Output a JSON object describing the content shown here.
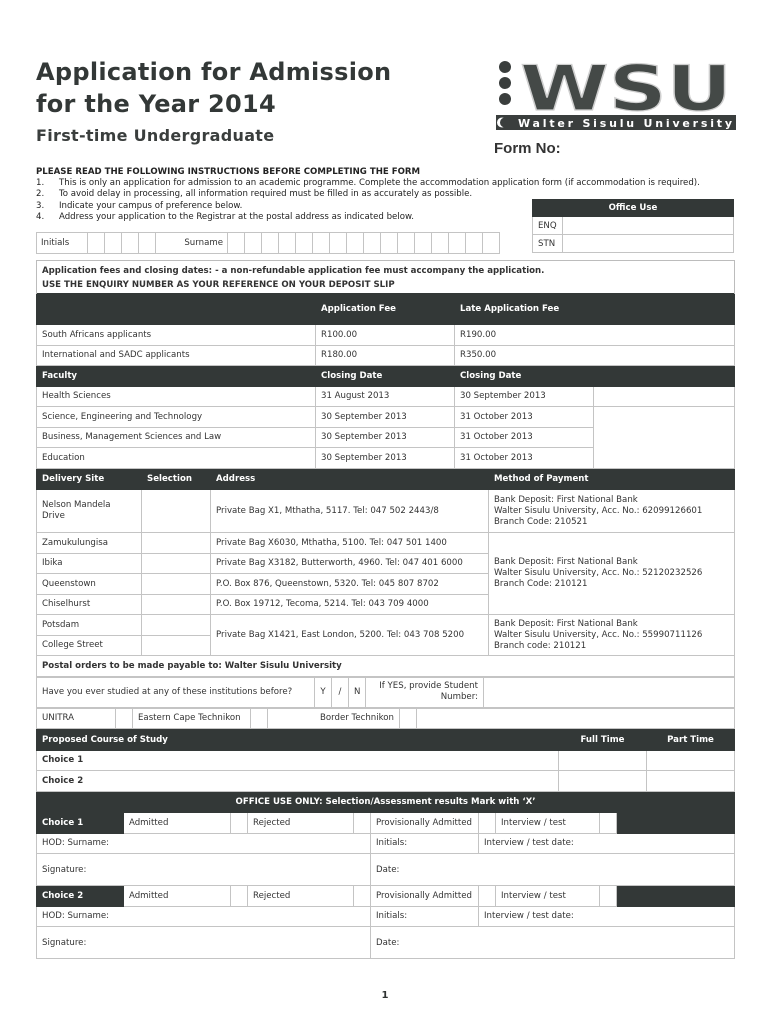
{
  "header": {
    "title_line1": "Application for Admission",
    "title_line2": "for the Year 2014",
    "subtitle": "First-time Undergraduate",
    "logo_text": "WSU",
    "logo_tagline": "Walter Sisulu University",
    "form_no_label": "Form No:"
  },
  "instructions": {
    "title": "PLEASE READ THE FOLLOWING INSTRUCTIONS BEFORE COMPLETING THE FORM",
    "items": [
      {
        "num": "1.",
        "text": "This is only an application for admission to an academic programme. Complete the accommodation application form (if accommodation is required)."
      },
      {
        "num": "2.",
        "text": "To avoid delay in processing, all information required must be filled in as accurately as possible."
      },
      {
        "num": "3.",
        "text": "Indicate your campus of preference below."
      },
      {
        "num": "4.",
        "text": "Address your application to the Registrar at the postal address as indicated below."
      }
    ]
  },
  "office_use": {
    "title": "Office Use",
    "rows": [
      {
        "label": "ENQ",
        "value": ""
      },
      {
        "label": "STN",
        "value": ""
      }
    ]
  },
  "name_row": {
    "initials_label": "Initials",
    "surname_label": "Surname",
    "initials_boxes": 4,
    "surname_boxes": 16
  },
  "fees": {
    "intro": "Application fees and closing dates: - a non-refundable application fee must accompany the application.",
    "reference_note": "USE THE ENQUIRY NUMBER AS YOUR REFERENCE ON YOUR DEPOSIT SLIP",
    "columns": [
      "",
      "Application Fee",
      "Late Application Fee"
    ],
    "rows": [
      {
        "applicant": "South Africans applicants",
        "fee": "R100.00",
        "late_fee": "R190.00"
      },
      {
        "applicant": "International and SADC applicants",
        "fee": "R180.00",
        "late_fee": "R350.00"
      }
    ]
  },
  "closing": {
    "columns": [
      "Faculty",
      "Closing Date",
      "Closing Date"
    ],
    "rows": [
      {
        "faculty": "Health Sciences",
        "date1": "31 August 2013",
        "date2": "30 September 2013"
      },
      {
        "faculty": "Science, Engineering and Technology",
        "date1": "30 September 2013",
        "date2": "31 October 2013"
      },
      {
        "faculty": "Business, Management Sciences and Law",
        "date1": "30 September 2013",
        "date2": "31 October 2013"
      },
      {
        "faculty": "Education",
        "date1": "30 September 2013",
        "date2": "31 October 2013"
      }
    ]
  },
  "delivery": {
    "columns": [
      "Delivery Site",
      "Selection",
      "Address",
      "Method of Payment"
    ],
    "sites": [
      {
        "site": "Nelson Mandela Drive",
        "address": "Private Bag X1, Mthatha, 5117.  Tel: 047 502 2443/8"
      },
      {
        "site": "Zamukulungisa",
        "address": "Private Bag X6030, Mthatha, 5100.  Tel: 047 501 1400"
      },
      {
        "site": "Ibika",
        "address": "Private Bag X3182, Butterworth, 4960.  Tel: 047 401 6000"
      },
      {
        "site": "Queenstown",
        "address": "P.O. Box 876, Queenstown, 5320.  Tel: 045 807 8702"
      },
      {
        "site": "Chiselhurst",
        "address": "P.O. Box 19712, Tecoma, 5214.  Tel: 043 709 4000"
      },
      {
        "site": "Potsdam",
        "address": "Private Bag X1421, East London, 5200.  Tel: 043 708 5200"
      },
      {
        "site": "College Street",
        "address": ""
      }
    ],
    "payments": [
      {
        "line1": "Bank Deposit:  First National Bank",
        "line2": "Walter Sisulu University, Acc. No.: 62099126601",
        "line3": "Branch Code: 210521"
      },
      {
        "line1": "Bank Deposit:  First National Bank",
        "line2": "Walter Sisulu University, Acc. No.: 52120232526",
        "line3": "Branch Code: 210121"
      },
      {
        "line1": "Bank Deposit:  First National Bank",
        "line2": "Walter Sisulu University, Acc. No.: 55990711126",
        "line3": "Branch code: 210121"
      }
    ],
    "postal_orders": "Postal orders to be made payable to: Walter Sisulu University"
  },
  "previous_study": {
    "question": "Have you ever studied at any of these institutions before?",
    "yes": "Y",
    "slash": "/",
    "no": "N",
    "student_number_label": "If YES, provide Student Number:",
    "institutions": [
      "UNITRA",
      "Eastern Cape Technikon",
      "Border Technikon"
    ]
  },
  "course": {
    "header": "Proposed Course of Study",
    "full_time": "Full Time",
    "part_time": "Part Time",
    "choices": [
      "Choice 1",
      "Choice 2"
    ]
  },
  "office_only": {
    "title": "OFFICE USE ONLY:  Selection/Assessment results Mark with ‘X’",
    "blocks": [
      {
        "choice": "Choice 1"
      },
      {
        "choice": "Choice 2"
      }
    ],
    "options": [
      "Admitted",
      "Rejected",
      "Provisionally Admitted",
      "Interview / test"
    ],
    "hod_surname": "HOD: Surname:",
    "initials": "Initials:",
    "interview_date": "Interview / test date:",
    "signature": "Signature:",
    "date": "Date:"
  },
  "page_number": "1"
}
